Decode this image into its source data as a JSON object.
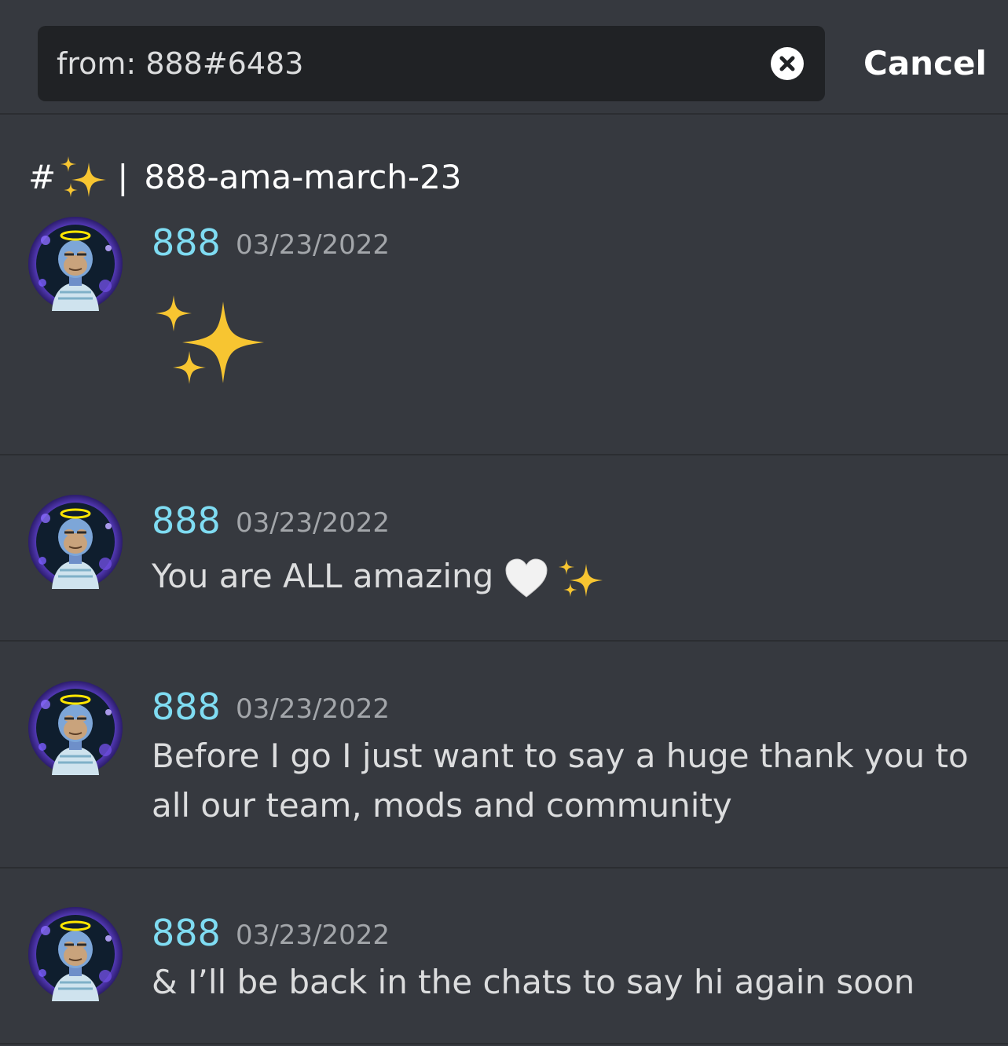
{
  "search": {
    "query": "from: 888#6483",
    "cancel_label": "Cancel"
  },
  "channel": {
    "hash": "#",
    "separator": "|",
    "name": "888-ama-march-23"
  },
  "messages": [
    {
      "username": "888",
      "timestamp": "03/23/2022",
      "text": ""
    },
    {
      "username": "888",
      "timestamp": "03/23/2022",
      "text": "You are ALL amazing"
    },
    {
      "username": "888",
      "timestamp": "03/23/2022",
      "text": "Before I go I just want to say a huge thank you to all our team, mods and community"
    },
    {
      "username": "888",
      "timestamp": "03/23/2022",
      "text": "& I’ll be back in the chats to say hi again soon"
    }
  ],
  "icons": {
    "clear": "close-circle-icon",
    "sparkles": "sparkles-emoji",
    "heart": "white-heart-emoji",
    "avatar": "ape-halo-avatar"
  },
  "colors": {
    "background": "#36393f",
    "search_bg": "#202225",
    "username": "#7fdcf2",
    "timestamp": "#a3a6aa",
    "text": "#dcddde"
  }
}
